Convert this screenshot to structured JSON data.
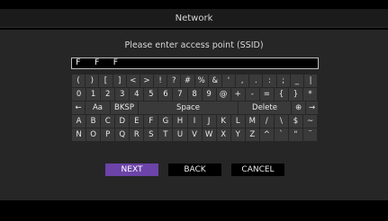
{
  "header": {
    "title": "Network"
  },
  "prompt": "Please enter access point (SSID)",
  "ssid_field": {
    "value": "F F F"
  },
  "keyboard": {
    "row1": [
      "(",
      ")",
      "[",
      "]",
      "<",
      ">",
      "!",
      "?",
      "#",
      "%",
      "&",
      "'",
      ",",
      ".",
      ":",
      ";",
      "_",
      "|"
    ],
    "row2": [
      "0",
      "1",
      "2",
      "3",
      "4",
      "5",
      "6",
      "7",
      "8",
      "9",
      "@",
      "+",
      "-",
      "=",
      "{",
      "}",
      "*"
    ],
    "row3": {
      "left_arrow": "←",
      "case_toggle": "Aa",
      "backspace": "BKSP",
      "space": "Space",
      "delete": "Delete",
      "globe": "⊕",
      "right_arrow": "→"
    },
    "row4": [
      "A",
      "B",
      "C",
      "D",
      "E",
      "F",
      "G",
      "H",
      "I",
      "J",
      "K",
      "L",
      "M",
      "/",
      "\\",
      "$",
      "~"
    ],
    "row5": [
      "N",
      "O",
      "P",
      "Q",
      "R",
      "S",
      "T",
      "U",
      "V",
      "W",
      "X",
      "Y",
      "Z",
      "^",
      "`",
      "\"",
      "¨"
    ]
  },
  "actions": {
    "next": "NEXT",
    "back": "BACK",
    "cancel": "CANCEL"
  },
  "colors": {
    "selected_button": "#6c43a8",
    "panel": "#262626",
    "key": "#3a3a3a"
  }
}
